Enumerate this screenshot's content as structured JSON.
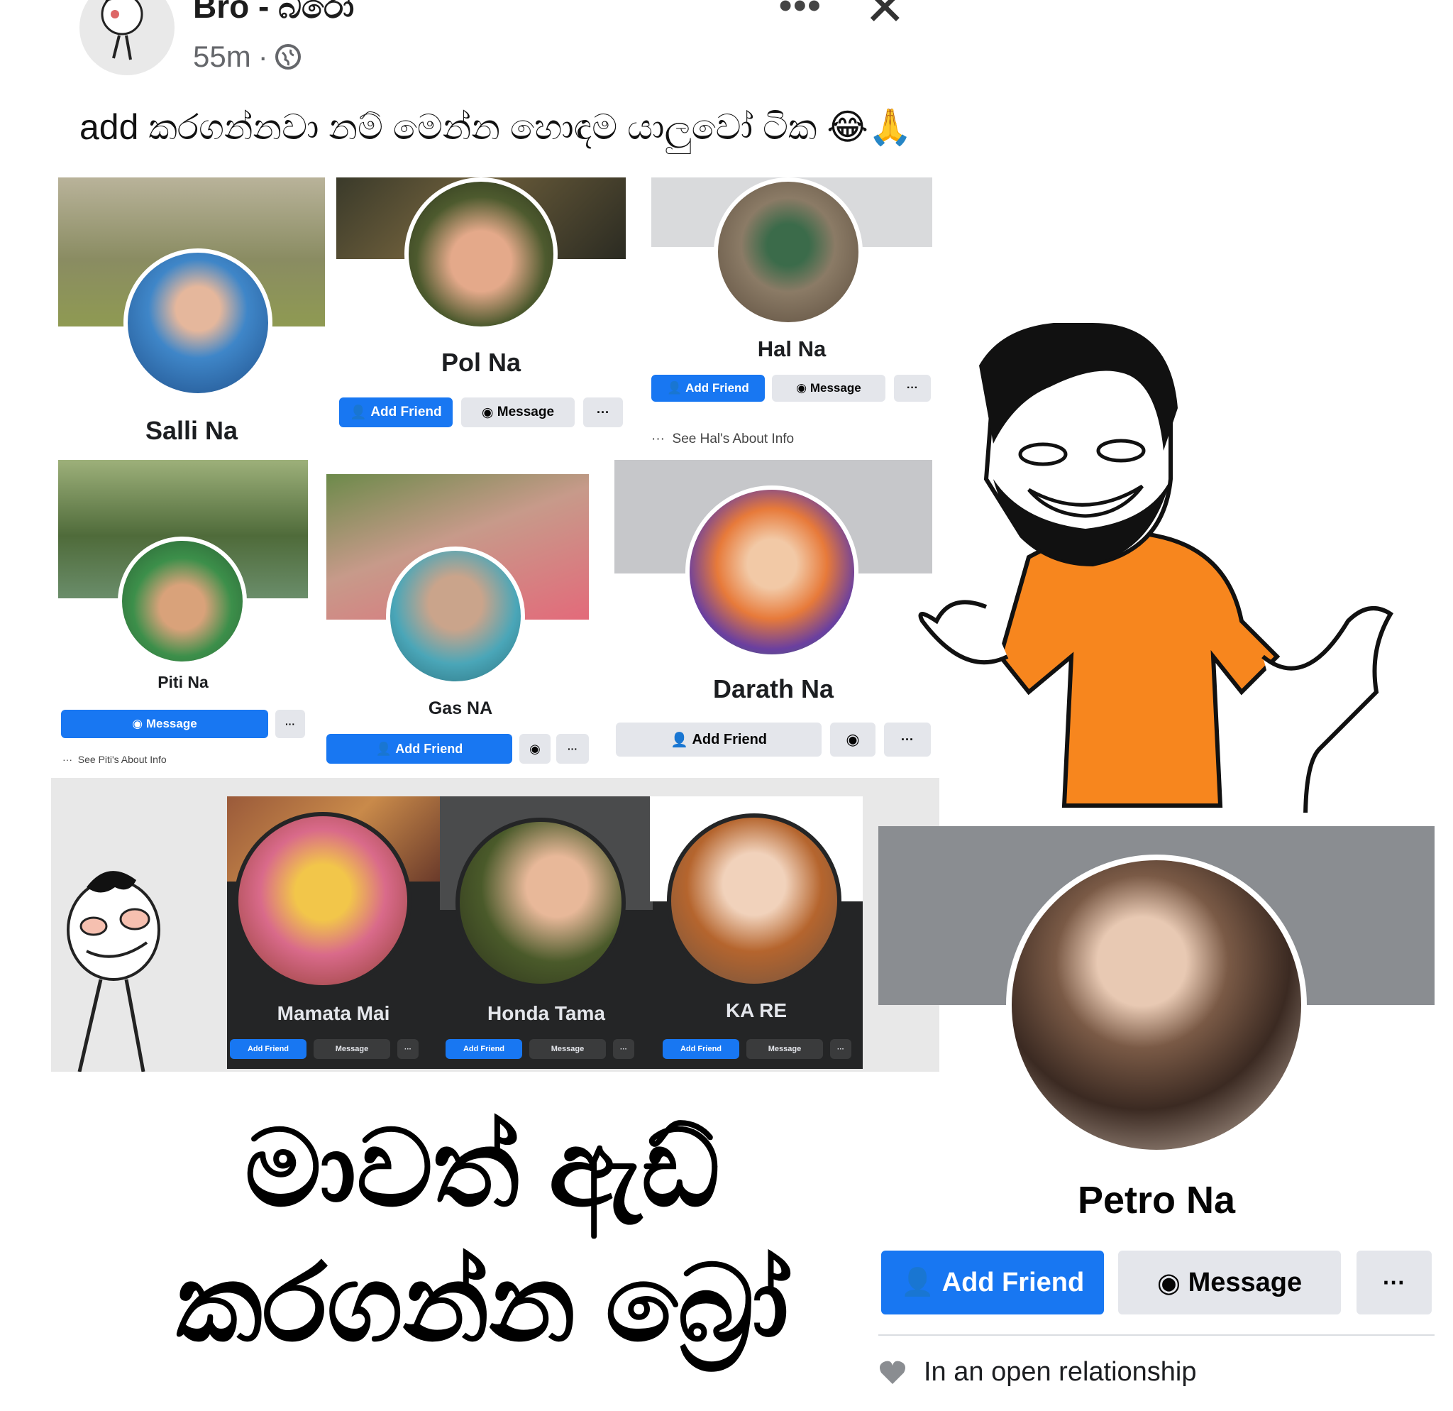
{
  "post": {
    "author": "Bro - බරෝ",
    "time": "55m",
    "separator": "·",
    "privacy_icon": "globe-icon",
    "more_icon": "more-dots-icon",
    "close_icon": "close-icon",
    "caption": "add කරගන්නවා නම් මෙන්න හොඳම යාලුවෝ ටික 😂🙏"
  },
  "profiles": [
    {
      "name": "Salli Na"
    },
    {
      "name": "Pol Na",
      "add": "Add Friend",
      "message": "Message",
      "more": "···"
    },
    {
      "name": "Hal Na",
      "add": "Add Friend",
      "message": "Message",
      "more": "···",
      "about": "See Hal's About Info"
    },
    {
      "name": "Piti Na",
      "message": "Message",
      "more": "···",
      "about": "See Piti's About Info"
    },
    {
      "name": "Gas NA",
      "add": "Add Friend",
      "more": "···"
    },
    {
      "name": "Darath Na",
      "add": "Add Friend",
      "more": "···"
    },
    {
      "name": "Mamata Mai",
      "add": "Add Friend",
      "message": "Message",
      "more": "···"
    },
    {
      "name": "Honda Tama",
      "add": "Add Friend",
      "message": "Message",
      "more": "···"
    },
    {
      "name": "KA RE",
      "add": "Add Friend",
      "message": "Message",
      "more": "···"
    }
  ],
  "meme_text": {
    "line1": "මාවත් ඇඩ්",
    "line2": "කරගන්න බ්‍රෝ"
  },
  "petro": {
    "name": "Petro Na",
    "add": "Add Friend",
    "message": "Message",
    "more": "···",
    "relationship": "In an open relationship"
  },
  "colors": {
    "fb_blue": "#1877f2",
    "button_grey": "#e4e6eb",
    "cover_grey": "#8a8d91",
    "shirt_orange": "#f7861e"
  }
}
